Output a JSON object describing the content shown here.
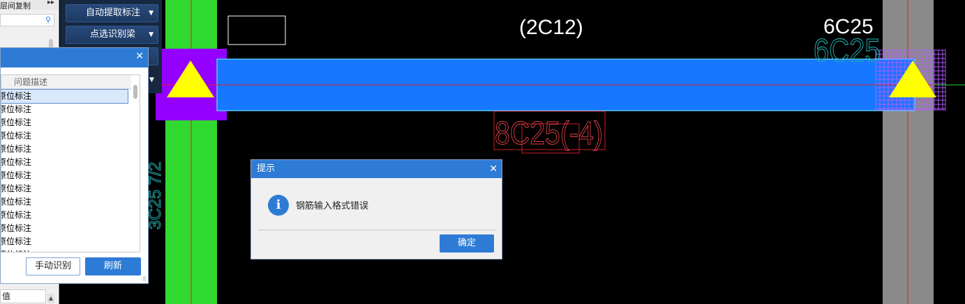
{
  "left_panel": {
    "header_label": "层间复制",
    "search_icon": "search-icon",
    "value_label": "值"
  },
  "toolbar": {
    "auto_extract_label": "自动提取标注",
    "pick_beam_label": "点选识别梁"
  },
  "issue_dialog": {
    "column_header": "问题描述",
    "rows": [
      "原位标注",
      "原位标注",
      "原位标注",
      "原位标注",
      "原位标注",
      "原位标注",
      "原位标注",
      "原位标注",
      "原位标注",
      "原位标注",
      "原位标注",
      "原位标注",
      "原位标注",
      "原位标注"
    ],
    "selected_index": 0,
    "manual_button": "手动识别",
    "refresh_button": "刷新"
  },
  "cad": {
    "annotation_top_center": "(2C12)",
    "annotation_top_right": "6C25",
    "annotation_top_right_ghost": "6C25",
    "annotation_bottom": "8C25(-4)",
    "annotation_vertical": "3C25 7/2",
    "colors": {
      "beam": "#1677ff",
      "column_green": "#30d930",
      "column_gray": "#8a8a8a",
      "marker_yellow": "#ffff00",
      "marker_purple": "#9400ff",
      "axis_red": "#e0202a"
    }
  },
  "message_box": {
    "title": "提示",
    "message": "钢筋输入格式错误",
    "ok_button": "确定",
    "icon": "info-icon"
  }
}
